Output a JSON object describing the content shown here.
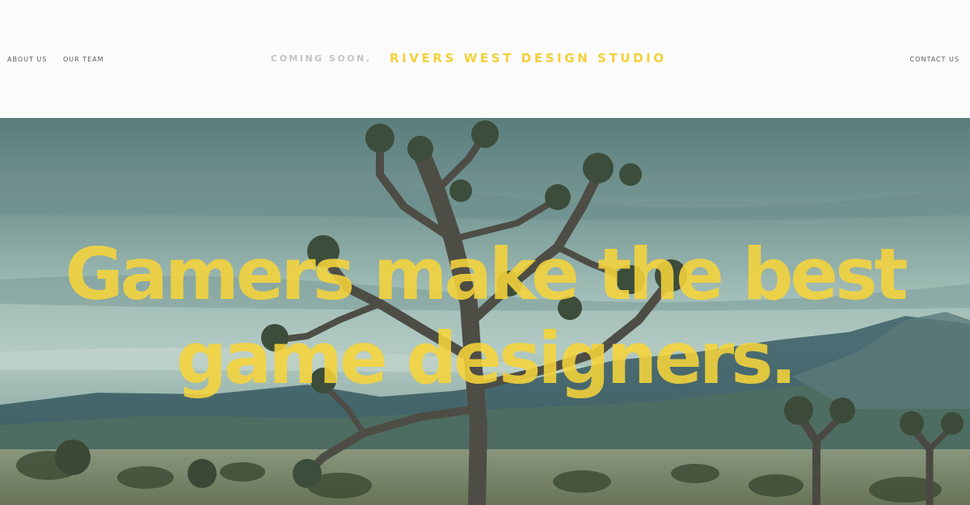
{
  "nav": {
    "about_label": "ABOUT US",
    "team_label": "OUR TEAM",
    "contact_label": "CONTACT US"
  },
  "header": {
    "coming_soon": "COMING SOON.",
    "brand": "RIVERS WEST DESIGN STUDIO"
  },
  "hero": {
    "headline_line1": "Gamers make the best",
    "headline_line2": "game designers."
  },
  "colors": {
    "accent": "#f3d03a",
    "header_bg": "#fbfbfb",
    "muted_text": "#c4c4c4"
  }
}
